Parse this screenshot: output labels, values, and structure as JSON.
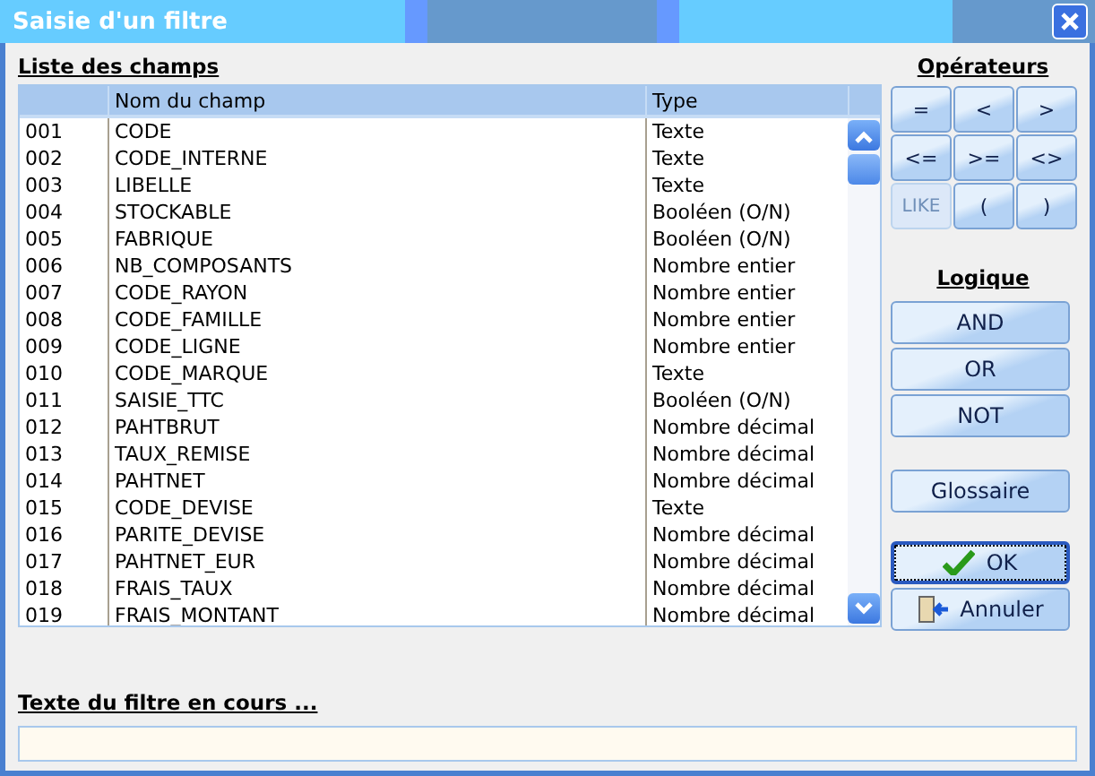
{
  "window": {
    "title": "Saisie d'un filtre"
  },
  "fields_list": {
    "heading": "Liste des champs",
    "columns": [
      "Nom du champ",
      "Type"
    ],
    "rows": [
      {
        "num": "001",
        "name": "CODE",
        "type": "Texte"
      },
      {
        "num": "002",
        "name": "CODE_INTERNE",
        "type": "Texte"
      },
      {
        "num": "003",
        "name": "LIBELLE",
        "type": "Texte"
      },
      {
        "num": "004",
        "name": "STOCKABLE",
        "type": "Booléen (O/N)"
      },
      {
        "num": "005",
        "name": "FABRIQUE",
        "type": "Booléen (O/N)"
      },
      {
        "num": "006",
        "name": "NB_COMPOSANTS",
        "type": "Nombre entier"
      },
      {
        "num": "007",
        "name": "CODE_RAYON",
        "type": "Nombre entier"
      },
      {
        "num": "008",
        "name": "CODE_FAMILLE",
        "type": "Nombre entier"
      },
      {
        "num": "009",
        "name": "CODE_LIGNE",
        "type": "Nombre entier"
      },
      {
        "num": "010",
        "name": "CODE_MARQUE",
        "type": "Texte"
      },
      {
        "num": "011",
        "name": "SAISIE_TTC",
        "type": "Booléen (O/N)"
      },
      {
        "num": "012",
        "name": "PAHTBRUT",
        "type": "Nombre décimal"
      },
      {
        "num": "013",
        "name": "TAUX_REMISE",
        "type": "Nombre décimal"
      },
      {
        "num": "014",
        "name": "PAHTNET",
        "type": "Nombre décimal"
      },
      {
        "num": "015",
        "name": "CODE_DEVISE",
        "type": "Texte"
      },
      {
        "num": "016",
        "name": "PARITE_DEVISE",
        "type": "Nombre décimal"
      },
      {
        "num": "017",
        "name": "PAHTNET_EUR",
        "type": "Nombre décimal"
      },
      {
        "num": "018",
        "name": "FRAIS_TAUX",
        "type": "Nombre décimal"
      },
      {
        "num": "019",
        "name": "FRAIS_MONTANT",
        "type": "Nombre décimal"
      }
    ]
  },
  "operators": {
    "heading": "Opérateurs",
    "buttons": [
      {
        "label": "=",
        "disabled": false
      },
      {
        "label": "<",
        "disabled": false
      },
      {
        "label": ">",
        "disabled": false
      },
      {
        "label": "<=",
        "disabled": false
      },
      {
        "label": ">=",
        "disabled": false
      },
      {
        "label": "<>",
        "disabled": false
      },
      {
        "label": "LIKE",
        "disabled": true
      },
      {
        "label": "(",
        "disabled": false
      },
      {
        "label": ")",
        "disabled": false
      }
    ]
  },
  "logic": {
    "heading": "Logique",
    "buttons": [
      "AND",
      "OR",
      "NOT"
    ]
  },
  "glossary_button": "Glossaire",
  "ok_button": "OK",
  "cancel_button": "Annuler",
  "filter_text": {
    "label": "Texte du filtre en cours ..."
  }
}
